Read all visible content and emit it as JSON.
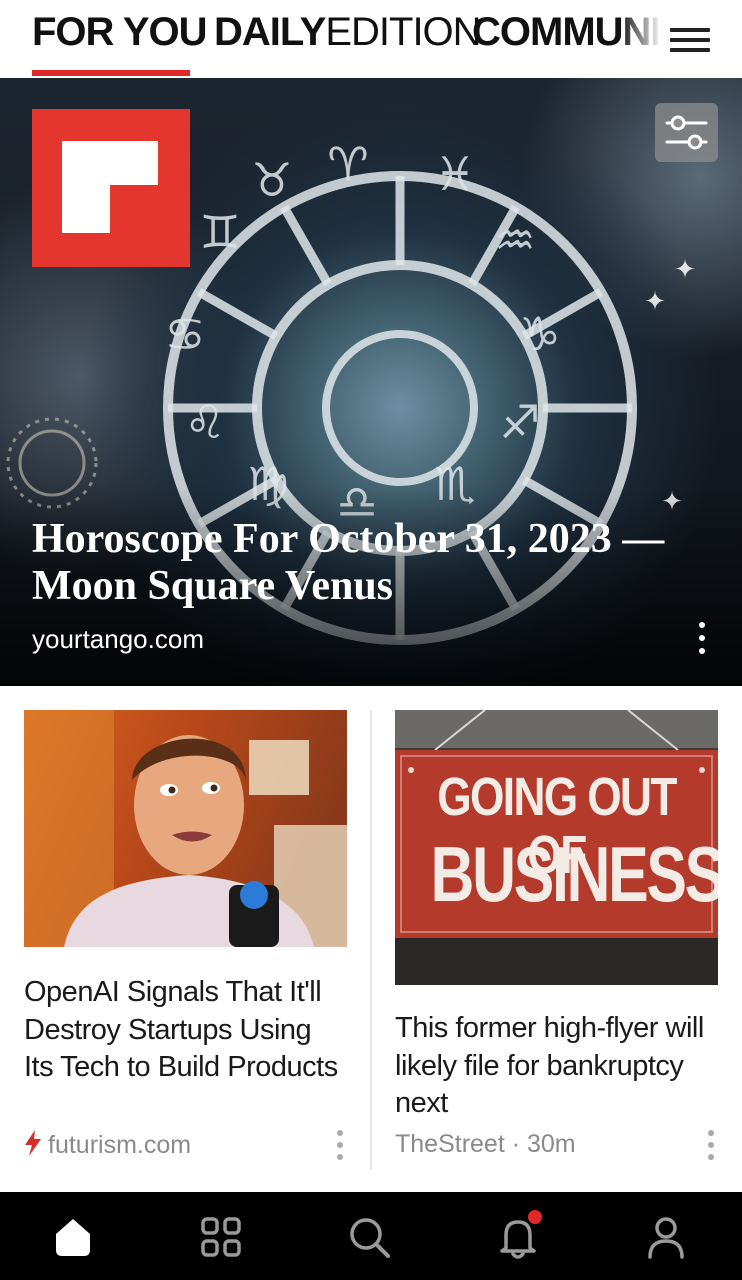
{
  "tabs": {
    "items": [
      {
        "label": "FOR YOU"
      },
      {
        "label_bold": "DAILY",
        "label_light": "EDITION"
      },
      {
        "label": "COMMUNI"
      }
    ],
    "active_index": 0,
    "indicator_color": "#e12828"
  },
  "hero": {
    "title": "Horoscope For October 31, 2023 — Moon Square Venus",
    "source": "yourtango.com",
    "logo_color": "#e4362e",
    "icons": {
      "logo": "flipboard-logo",
      "filter": "filter-sliders-icon",
      "more": "more-vertical-icon"
    }
  },
  "cards": [
    {
      "title": "OpenAI Signals That It'll Destroy Startups Using Its Tech to Build Products",
      "source": "futurism.com",
      "source_icon": "lightning-icon",
      "source_icon_color": "#e12828",
      "image_desc": "man-being-interviewed-photo"
    },
    {
      "title": "This former high-flyer will likely file for bankruptcy next",
      "source": "TheStreet · 30m",
      "sign_line1": "GOING OUT OF",
      "sign_line2": "BUSINESS"
    }
  ],
  "bottom_nav": {
    "items": [
      {
        "icon": "home-icon",
        "active": true
      },
      {
        "icon": "grid-icon"
      },
      {
        "icon": "search-icon"
      },
      {
        "icon": "bell-icon",
        "badge": true,
        "badge_color": "#e12828"
      },
      {
        "icon": "profile-icon"
      }
    ]
  }
}
